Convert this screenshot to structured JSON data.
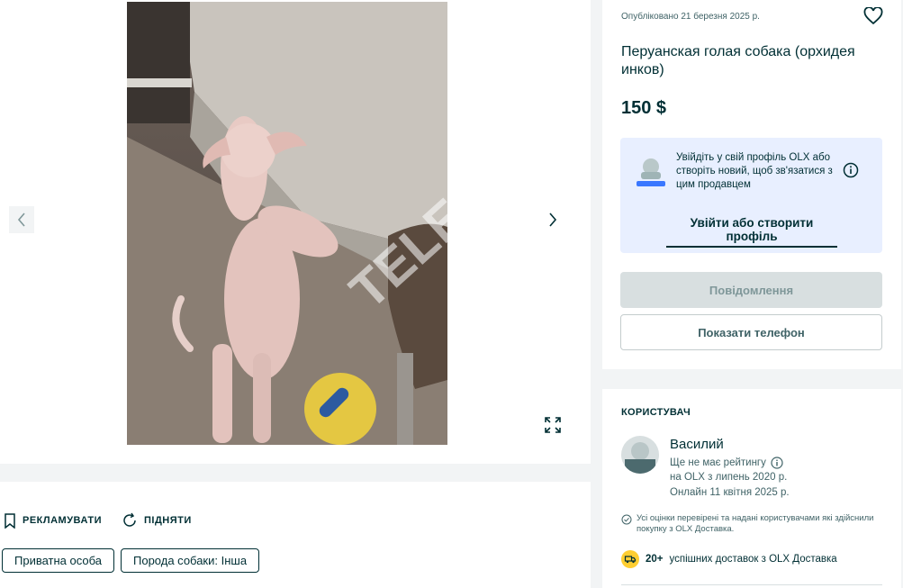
{
  "ad": {
    "published": "Опубліковано 21 березня 2025 р.",
    "title": "Перуанская голая собака (орхидея инков)",
    "price": "150 $",
    "login_prompt": "Увійдіть у свій профіль OLX або створіть новий, щоб зв'язатися з цим продавцем",
    "login_link": "Увійти або створити профіль",
    "message_button": "Повідомлення",
    "phone_button": "Показати телефон"
  },
  "gallery": {
    "watermark": "TELEGRAF"
  },
  "actions": {
    "promote": "РЕКЛАМУВАТИ",
    "raise": "ПІДНЯТИ"
  },
  "tags": [
    "Приватна особа",
    "Порода собаки: Інша"
  ],
  "user": {
    "heading": "КОРИСТУВАЧ",
    "name": "Василий",
    "rating": "Ще не має рейтингу",
    "member_since": "на OLX з липень 2020 р.",
    "online": "Онлайн 11 квітня 2025 р.",
    "verified_note": "Усі оцінки перевірені та надані користувачами які здійснили покупку з OLX Доставка.",
    "deliveries_count": "20+",
    "deliveries_text": "успішних доставок з OLX Доставка"
  },
  "icons": {
    "heart": "heart-icon",
    "info": "info-icon",
    "prev": "chevron-left-icon",
    "next": "chevron-right-icon",
    "expand": "expand-icon",
    "promote": "bookmark-icon",
    "raise": "refresh-icon",
    "verified": "check-circle-icon",
    "delivery": "truck-icon"
  },
  "colors": {
    "primary": "#002f34",
    "login_bg": "#e8efff",
    "delivery_badge": "#ffce32",
    "disabled_button": "#d8dfe0"
  }
}
